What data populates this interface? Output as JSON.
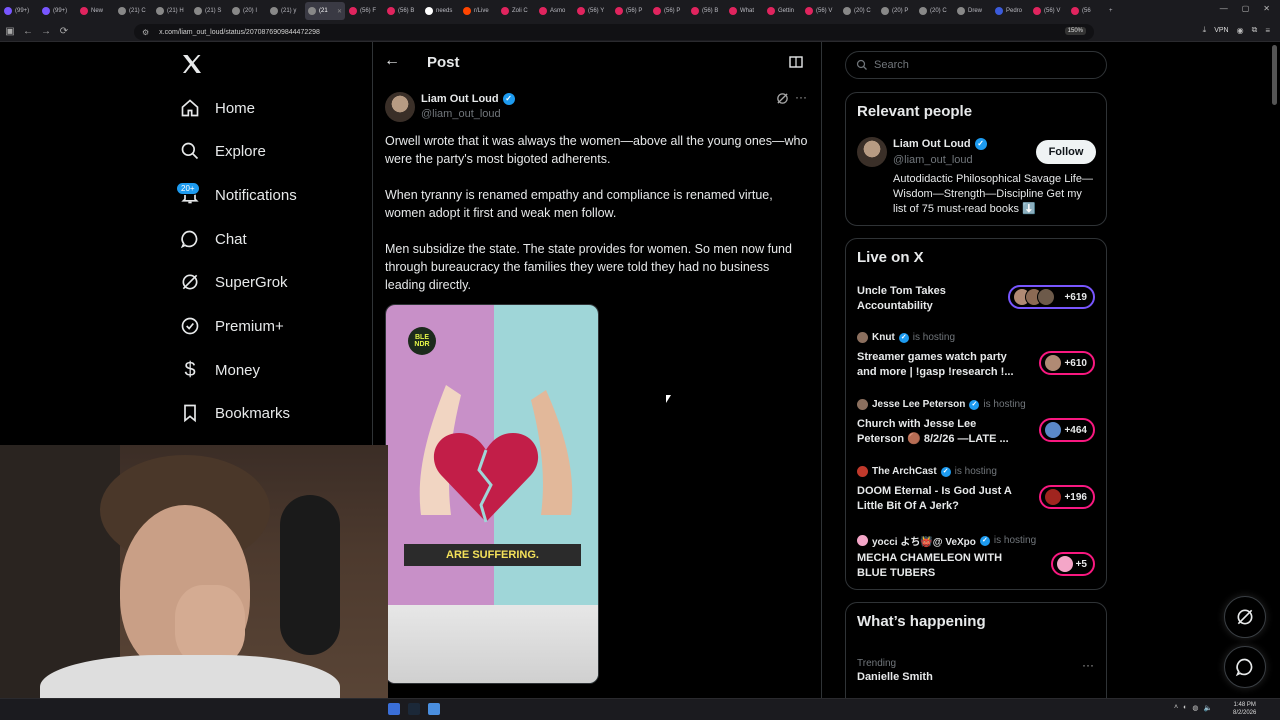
{
  "browser": {
    "tabs": [
      {
        "label": "(99+)",
        "color": "#7856ff"
      },
      {
        "label": "(99+)",
        "color": "#7856ff"
      },
      {
        "label": "New",
        "color": "#e0245e"
      },
      {
        "label": "(21) C",
        "color": "#888888"
      },
      {
        "label": "(21) H",
        "color": "#888888"
      },
      {
        "label": "(21) S",
        "color": "#888888"
      },
      {
        "label": "(20) I",
        "color": "#888888"
      },
      {
        "label": "(21) y",
        "color": "#888888"
      },
      {
        "label": "(21",
        "color": "#888888",
        "active": true
      },
      {
        "label": "(56) F",
        "color": "#e0245e"
      },
      {
        "label": "(56) B",
        "color": "#e0245e"
      },
      {
        "label": "needs",
        "color": "#ffffff"
      },
      {
        "label": "r/Live",
        "color": "#ff4500"
      },
      {
        "label": "Zoli C",
        "color": "#e0245e"
      },
      {
        "label": "Asmo",
        "color": "#e0245e"
      },
      {
        "label": "(56) Y",
        "color": "#e0245e"
      },
      {
        "label": "(56) P",
        "color": "#e0245e"
      },
      {
        "label": "(56) P",
        "color": "#e0245e"
      },
      {
        "label": "(56) B",
        "color": "#e0245e"
      },
      {
        "label": "What",
        "color": "#e0245e"
      },
      {
        "label": "Gettin",
        "color": "#e0245e"
      },
      {
        "label": "(56) V",
        "color": "#e0245e"
      },
      {
        "label": "(20) C",
        "color": "#888888"
      },
      {
        "label": "(20) P",
        "color": "#888888"
      },
      {
        "label": "(20) C",
        "color": "#888888"
      },
      {
        "label": "Drew",
        "color": "#888888"
      },
      {
        "label": "Pedro",
        "color": "#3b5bdb"
      },
      {
        "label": "(56) V",
        "color": "#e0245e"
      },
      {
        "label": "(56",
        "color": "#e0245e"
      }
    ],
    "url": "x.com/liam_out_loud/status/2070876909844472298",
    "zoom": "150%",
    "vpn": "VPN"
  },
  "nav": {
    "items": [
      {
        "label": "Home",
        "icon": "home-icon"
      },
      {
        "label": "Explore",
        "icon": "search-icon"
      },
      {
        "label": "Notifications",
        "icon": "bell-icon"
      },
      {
        "label": "Chat",
        "icon": "chat-icon"
      },
      {
        "label": "SuperGrok",
        "icon": "grok-icon"
      },
      {
        "label": "Premium+",
        "icon": "verified-icon"
      },
      {
        "label": "Money",
        "icon": "dollar-icon"
      },
      {
        "label": "Bookmarks",
        "icon": "bookmark-icon"
      }
    ],
    "notification_badge": "20+"
  },
  "post": {
    "header_title": "Post",
    "author_name": "Liam Out Loud",
    "author_handle": "@liam_out_loud",
    "paragraphs": [
      "Orwell wrote that it was always the women—above all the young ones—who were the party's most bigoted adherents.",
      "When tyranny is renamed empathy and compliance is renamed virtue, women adopt it first and weak men follow.",
      "Men subsidize the state. The state provides for women. So men now fund through bureaucracy the families they were told they had no business leading directly."
    ],
    "media": {
      "logo_text": "BLE NDR",
      "caption": "ARE SUFFERING."
    }
  },
  "search": {
    "placeholder": "Search"
  },
  "relevant_people": {
    "title": "Relevant people",
    "name": "Liam Out Loud",
    "handle": "@liam_out_loud",
    "follow_label": "Follow",
    "bio": "Autodidactic Philosophical Savage Life—Wisdom—Strength—Discipline Get my list of 75 must-read books ⬇️"
  },
  "live": {
    "title": "Live on X",
    "items": [
      {
        "host": "",
        "hosting": "",
        "title": "Uncle Tom Takes Accountability",
        "count": "+619",
        "pill": "purple"
      },
      {
        "host": "Knut",
        "hosting": "is hosting",
        "title": "Streamer games watch party and more | !gasp !research !...",
        "count": "+610",
        "pill": "pink"
      },
      {
        "host": "Jesse Lee Peterson",
        "hosting": "is hosting",
        "title": "Church with Jesse Lee Peterson 🟤 8/2/26 —LATE ...",
        "count": "+464",
        "pill": "pink"
      },
      {
        "host": "The ArchCast",
        "hosting": "is hosting",
        "title": "DOOM Eternal - Is God Just A Little Bit Of A Jerk?",
        "count": "+196",
        "pill": "pink"
      },
      {
        "host": "yocci よち👹@ VeXpo",
        "hosting": "is hosting",
        "title": "MECHA CHAMELEON WITH BLUE TUBERS",
        "count": "+5",
        "pill": "pink"
      }
    ]
  },
  "happening": {
    "title": "What’s happening",
    "trend_label": "Trending",
    "trend_name": "Danielle Smith"
  },
  "taskbar": {
    "time": "1:48 PM",
    "date": "8/2/2026"
  }
}
